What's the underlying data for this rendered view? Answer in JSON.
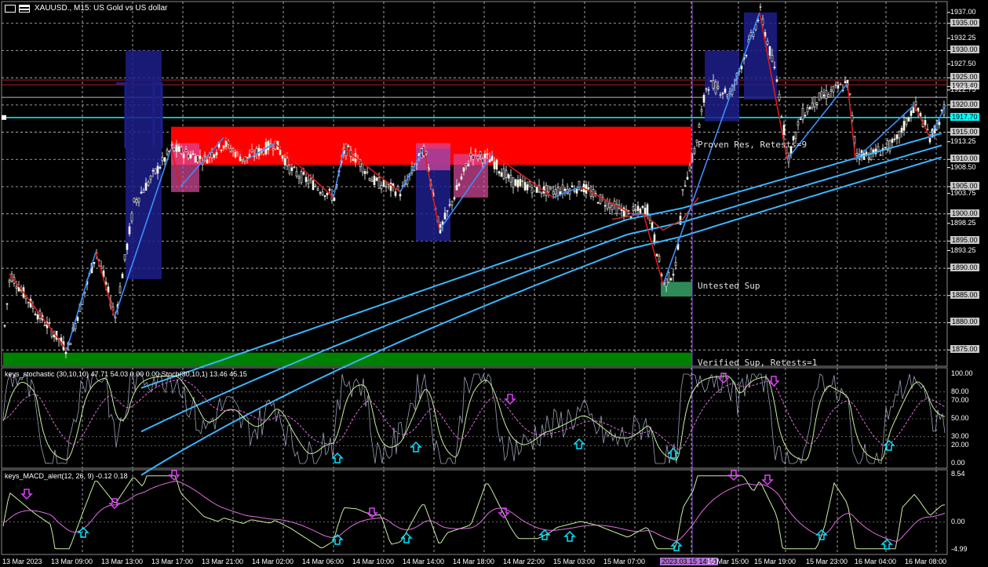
{
  "window": {
    "title": "XAUUSD., M15: US Gold vs US dollar"
  },
  "colors": {
    "background": "#000000",
    "grid": "#c8c8c8",
    "resistance_zone": "#ff0000",
    "support_zone": "#008000",
    "ma_line": "#39b6ff",
    "zigzag_down": "#e01a1a",
    "zigzag_up": "#3b8fff",
    "highlight_box": "#1c1f8a",
    "arrow_up": "#00e5ff",
    "arrow_down": "#e040fb"
  },
  "price_axis": {
    "labels": [
      "1937.00",
      "1935.00",
      "1932.25",
      "1930.00",
      "1927.50",
      "1925.00",
      "1923.40",
      "1922.75",
      "1920.00",
      "1917.70",
      "1915.00",
      "1913.25",
      "1910.00",
      "1908.50",
      "1905.00",
      "1903.75",
      "1900.00",
      "1898.25",
      "1895.00",
      "1893.25",
      "1890.00",
      "1885.00",
      "1880.00",
      "1875.00"
    ],
    "current_price": "1917.70",
    "range": [
      1872,
      1939
    ]
  },
  "zones": {
    "resistance_label": "Proven Res, Retests=9",
    "untested_label": "Untested Sup",
    "verified_label": "Verified Sup, Retests=1"
  },
  "stochastic": {
    "title": "keys_stochastic (30,10,10) 47.71 54.03 0.00 0.00 Stoch(30,10,1) 13.46 45.15",
    "levels": [
      "100.00",
      "80.00",
      "70.00",
      "50.00",
      "30.00",
      "20.00",
      "0.00"
    ]
  },
  "macd": {
    "title": "keys_MACD_alert(12, 26, 9) -0.12 0.18",
    "levels": [
      "8.54",
      "0.00",
      "-4.99"
    ]
  },
  "time_axis": {
    "labels": [
      "13 Mar 2023",
      "13 Mar 09:00",
      "13 Mar 13:00",
      "13 Mar 17:00",
      "13 Mar 21:00",
      "14 Mar 02:00",
      "14 Mar 06:00",
      "14 Mar 10:00",
      "14 Mar 14:00",
      "14 Mar 18:00",
      "14 Mar 22:00",
      "15 Mar 03:00",
      "15 Mar 07:00",
      "2023.03.15 14:00",
      "15 Mar 15:00",
      "15 Mar 19:00",
      "15 Mar 23:00",
      "16 Mar 04:00",
      "16 Mar 08:00"
    ],
    "highlight": "2023.03.15 14:00"
  }
}
